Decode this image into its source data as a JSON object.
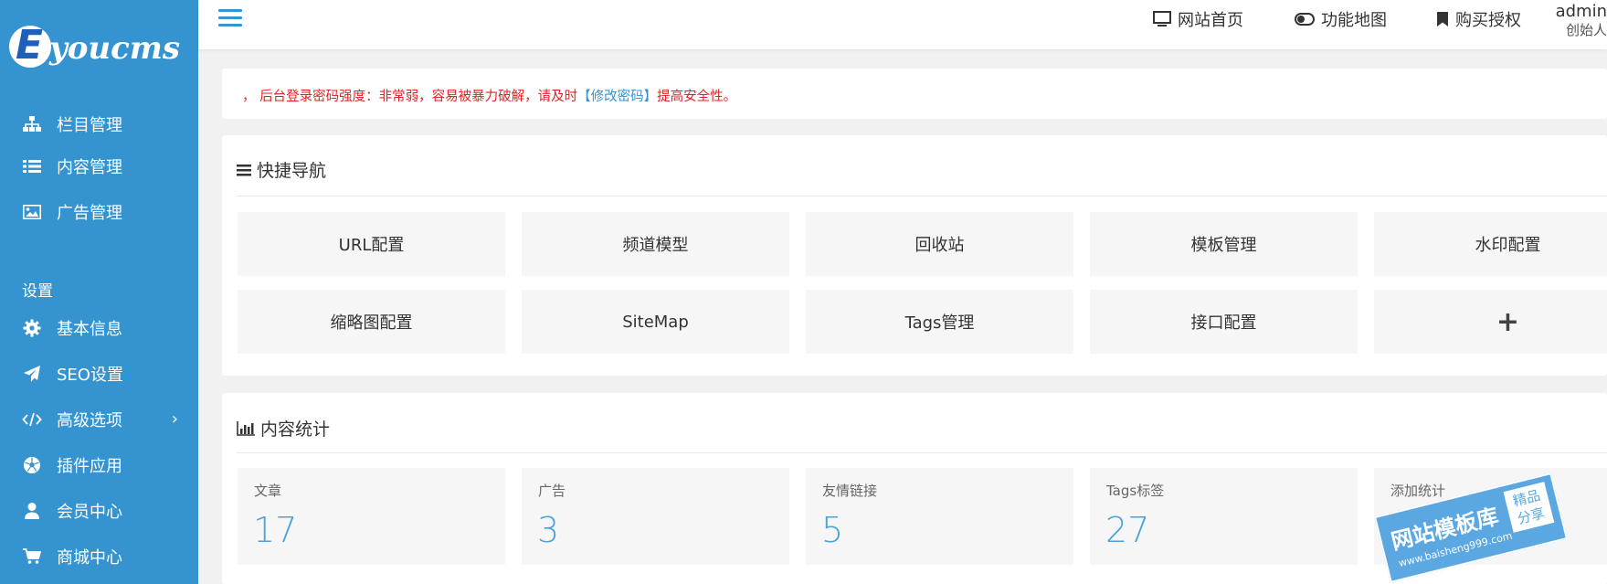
{
  "brand": {
    "logo_letter": "E",
    "logo_text": "youcms"
  },
  "sidebar": {
    "items_top": [
      {
        "label": "栏目管理",
        "icon": "sitemap-icon"
      },
      {
        "label": "内容管理",
        "icon": "list-icon"
      },
      {
        "label": "广告管理",
        "icon": "image-icon"
      }
    ],
    "section_label": "设置",
    "items_settings": [
      {
        "label": "基本信息",
        "icon": "gear-icon"
      },
      {
        "label": "SEO设置",
        "icon": "paper-plane-icon"
      },
      {
        "label": "高级选项",
        "icon": "code-icon",
        "chevron": "›"
      },
      {
        "label": "插件应用",
        "icon": "soccer-ball-icon"
      },
      {
        "label": "会员中心",
        "icon": "user-icon"
      },
      {
        "label": "商城中心",
        "icon": "cart-icon"
      }
    ]
  },
  "topbar": {
    "links": [
      {
        "label": "网站首页",
        "icon": "monitor-icon"
      },
      {
        "label": "功能地图",
        "icon": "toggle-icon"
      },
      {
        "label": "购买授权",
        "icon": "bookmark-icon"
      }
    ],
    "user": {
      "name": "admin",
      "role": "创始人"
    }
  },
  "alert": {
    "prefix": "，",
    "text_before": "后台登录密码强度：非常弱，容易被暴力破解，请及时",
    "link_text": "【修改密码】",
    "text_after": "提高安全性。"
  },
  "quick_nav": {
    "title": "快捷导航",
    "tiles": [
      "URL配置",
      "频道模型",
      "回收站",
      "模板管理",
      "水印配置",
      "缩略图配置",
      "SiteMap",
      "Tags管理",
      "接口配置",
      "+"
    ]
  },
  "stats": {
    "title": "内容统计",
    "cards": [
      {
        "label": "文章",
        "value": "17"
      },
      {
        "label": "广告",
        "value": "3"
      },
      {
        "label": "友情链接",
        "value": "5"
      },
      {
        "label": "Tags标签",
        "value": "27"
      },
      {
        "label": "添加统计",
        "value": ""
      }
    ]
  },
  "watermark": {
    "main": "网站模板库",
    "url": "www.baisheng999.com",
    "badge_top": "精品",
    "badge_bottom": "分享"
  },
  "colors": {
    "sidebar": "#3594cf",
    "accent": "#4aa3d8",
    "alert": "#e02222"
  }
}
